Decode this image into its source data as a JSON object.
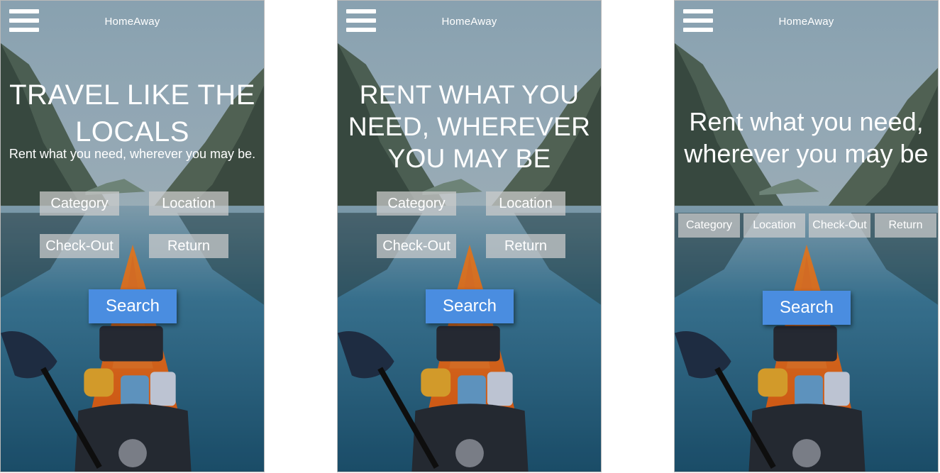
{
  "colors": {
    "accent": "#4a8de0",
    "field_bg": "rgba(205,205,205,0.72)",
    "kayak": "#f06a1c",
    "water": "#2f6f92"
  },
  "phones": [
    {
      "brand": "HomeAway",
      "menu_icon": "hamburger-icon",
      "headline_lines": [
        "TRAVEL LIKE THE",
        "LOCALS"
      ],
      "tagline": "Rent what you need, wherever you may be.",
      "fields": [
        "Category",
        "Location",
        "Check-Out",
        "Return"
      ],
      "search_label": "Search"
    },
    {
      "brand": "HomeAway",
      "menu_icon": "hamburger-icon",
      "headline_lines": [
        "RENT WHAT YOU",
        "NEED, WHEREVER",
        "YOU MAY BE"
      ],
      "fields": [
        "Category",
        "Location",
        "Check-Out",
        "Return"
      ],
      "search_label": "Search"
    },
    {
      "brand": "HomeAway",
      "menu_icon": "hamburger-icon",
      "headline_lines": [
        "Rent what you need,",
        "wherever you may be"
      ],
      "fields": [
        "Category",
        "Location",
        "Check-Out",
        "Return"
      ],
      "search_label": "Search"
    }
  ]
}
